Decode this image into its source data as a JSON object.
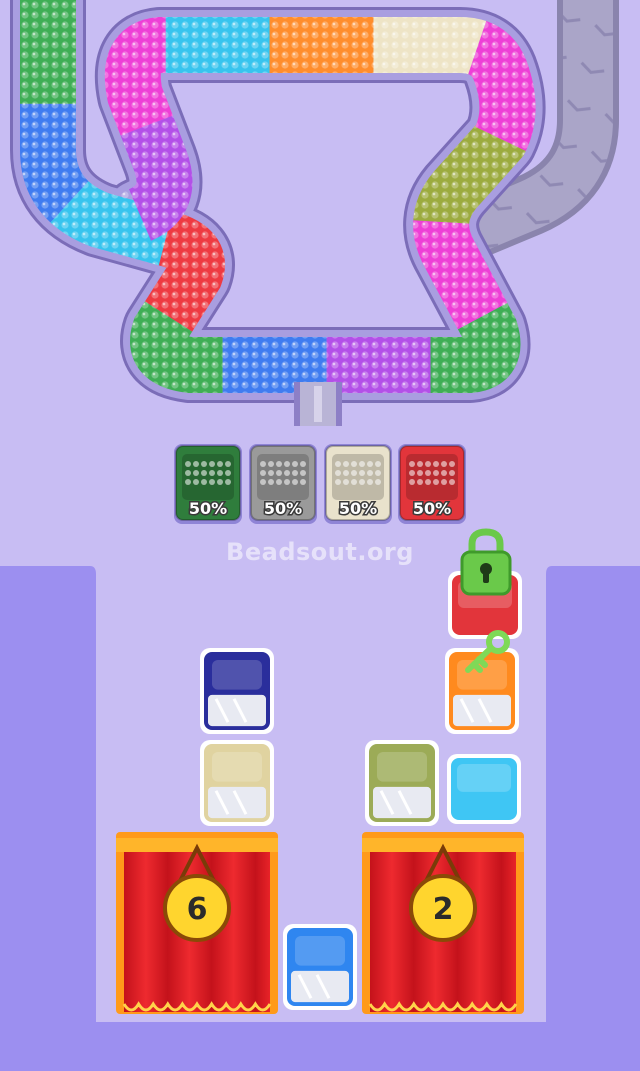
{
  "watermark": "Beadsout.org",
  "colors": {
    "background": "#c8bdf3",
    "panel": "#9c8ff0",
    "track_wall": "#8d7fc6",
    "conveyor": "#aaa5c8"
  },
  "bead_track": {
    "segments": [
      "green",
      "blue",
      "cyan",
      "red",
      "green",
      "blue",
      "purple",
      "green",
      "magenta",
      "olive",
      "magenta",
      "cream",
      "orange",
      "cyan",
      "magenta",
      "purple"
    ]
  },
  "collector_slots": [
    {
      "name": "green-slot",
      "color": "#2f7d3c",
      "percent": "50%"
    },
    {
      "name": "gray-slot",
      "color": "#9a9a9a",
      "percent": "50%"
    },
    {
      "name": "cream-slot",
      "color": "#e9e2cc",
      "percent": "50%"
    },
    {
      "name": "red-slot",
      "color": "#e2353b",
      "percent": "50%"
    }
  ],
  "boxes": [
    {
      "name": "navy-box",
      "color": "#2a2e9c"
    },
    {
      "name": "tan-box",
      "color": "#e0d3a0"
    },
    {
      "name": "olive-box",
      "color": "#9cab57"
    },
    {
      "name": "cyan-box",
      "color": "#3fc6f4"
    },
    {
      "name": "orange-box",
      "color": "#ff8a1e"
    },
    {
      "name": "red-locked-box",
      "color": "#e2353b"
    },
    {
      "name": "blue-box",
      "color": "#2f86f0"
    }
  ],
  "curtains": [
    {
      "name": "curtain-left",
      "count": "6"
    },
    {
      "name": "curtain-right",
      "count": "2"
    }
  ],
  "lock": {
    "icon": "padlock-icon",
    "color": "#6ac94a"
  },
  "key": {
    "icon": "key-icon",
    "color": "#7fd957"
  }
}
